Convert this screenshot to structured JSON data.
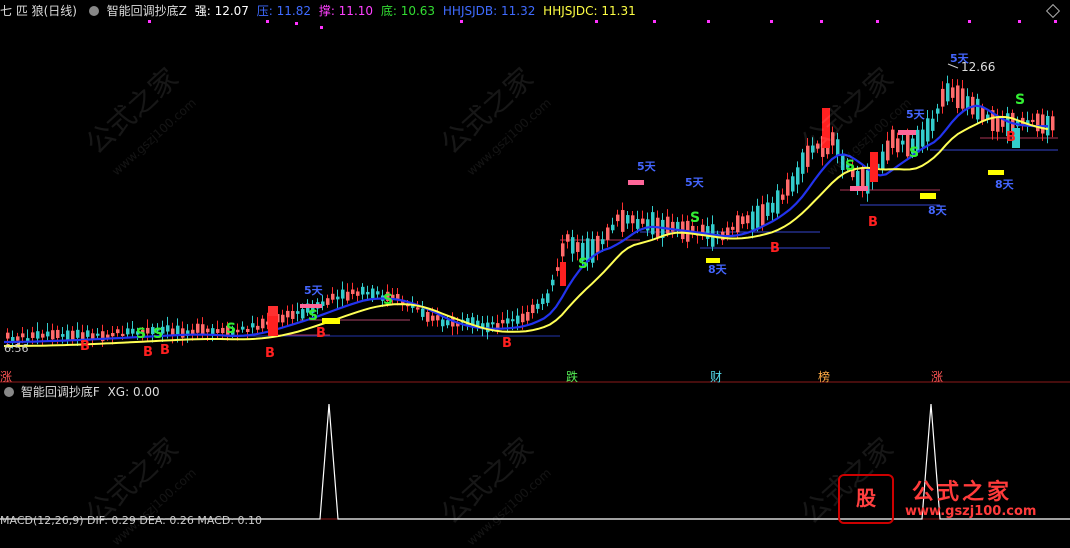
{
  "header": {
    "stock_name": "七 匹 狼(日线)",
    "indicator_name": "智能回调抄底Z",
    "values": [
      {
        "label": "强: 12.07",
        "color": "#ffffff"
      },
      {
        "label": "压: 11.82",
        "color": "#3f6bff"
      },
      {
        "label": "撑: 11.10",
        "color": "#ff40ff"
      },
      {
        "label": "底: 10.63",
        "color": "#33dd33"
      },
      {
        "label": "HHJSJDB: 11.32",
        "color": "#3f6bff"
      },
      {
        "label": "HHJSJDC: 11.31",
        "color": "#ffff44"
      }
    ]
  },
  "sub_panel": {
    "title": "智能回调抄底F",
    "xg_label": "XG: 0.00",
    "bottom_text": "MACD(12,26,9)  DIF: 0.29  DEA: 0.26  MACD: 0.10"
  },
  "price_labels": {
    "low": "6.56",
    "high": "12.66"
  },
  "categories": [
    {
      "label": "跌",
      "color": "#55ee55"
    },
    {
      "label": "财",
      "color": "#55ddee"
    },
    {
      "label": "榜",
      "color": "#ffaa44"
    },
    {
      "label": "涨",
      "color": "#ff5555"
    }
  ],
  "left_category_stub": "涨",
  "markers": {
    "b": "B",
    "s": "S",
    "five_days": "5天",
    "eight_days": "8天"
  },
  "watermark": {
    "cn": "公式之家",
    "url": "www.gszj100.com"
  },
  "logo": {
    "text": "公式之家",
    "url": "www.gszj100.com",
    "badge": "股"
  },
  "colors": {
    "up": "#ff3030",
    "down": "#33cccc",
    "ma_yellow": "#ffff55",
    "ma_blue": "#2233ee",
    "bg": "#000000",
    "magenta": "#ff33ff"
  }
}
